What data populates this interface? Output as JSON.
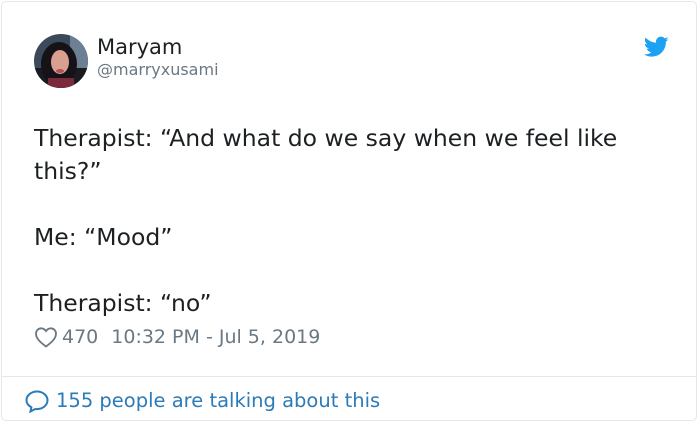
{
  "tweet": {
    "display_name": "Maryam",
    "handle": "@marryxusami",
    "text_lines": [
      "Therapist: “And what do we say when we feel like this?”",
      "Me: “Mood”",
      "Therapist: “no”"
    ],
    "likes": "470",
    "timestamp": "10:32 PM - Jul 5, 2019",
    "talking": "155 people are talking about this"
  },
  "icons": {
    "brand": "twitter-bird-icon",
    "like": "heart-icon",
    "reply": "speech-bubble-icon"
  },
  "colors": {
    "brand_blue": "#1da1f2",
    "link_blue": "#2b7bb9",
    "muted": "#697882",
    "text": "#1c2022",
    "border": "#e1e8ed"
  }
}
